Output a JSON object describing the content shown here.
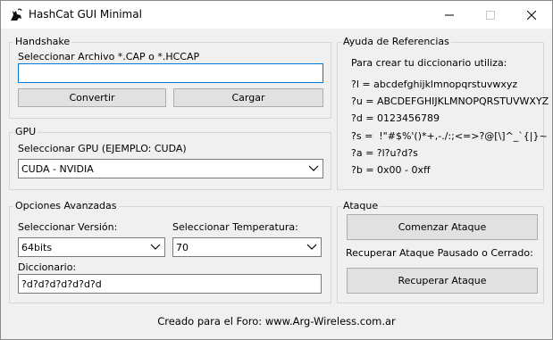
{
  "window": {
    "title": "HashCat GUI Minimal",
    "icon": "cat-icon"
  },
  "handshake": {
    "legend": "Handshake",
    "file_label": "Seleccionar Archivo *.CAP o *.HCCAP",
    "file_value": "",
    "convert_label": "Convertir",
    "load_label": "Cargar"
  },
  "gpu": {
    "legend": "GPU",
    "select_label": "Seleccionar GPU (EJEMPLO: CUDA)",
    "selected": "CUDA - NVIDIA"
  },
  "advanced": {
    "legend": "Opciones Avanzadas",
    "version_label": "Seleccionar Versión:",
    "version_selected": "64bits",
    "temp_label": "Seleccionar Temperatura:",
    "temp_selected": "70",
    "dict_label": "Diccionario:",
    "dict_value": "?d?d?d?d?d?d?d"
  },
  "reference": {
    "legend": "Ayuda de Referencias",
    "intro": "Para crear tu diccionario utiliza:",
    "lines": [
      "?l = abcdefghijklmnopqrstuvwxyz",
      "?u = ABCDEFGHIJKLMNOPQRSTUVWXYZ",
      "?d = 0123456789",
      "?s =  !\"#$%'()*+,-./:;<=>?@[\\]^_`{|}~",
      "?a = ?l?u?d?s",
      "?b = 0x00 - 0xff"
    ]
  },
  "attack": {
    "legend": "Ataque",
    "start_label": "Comenzar Ataque",
    "resume_text": "Recuperar Ataque Pausado o Cerrado:",
    "resume_label": "Recuperar Ataque"
  },
  "footer": {
    "text": "Creado para el Foro: www.Arg-Wireless.com.ar"
  }
}
